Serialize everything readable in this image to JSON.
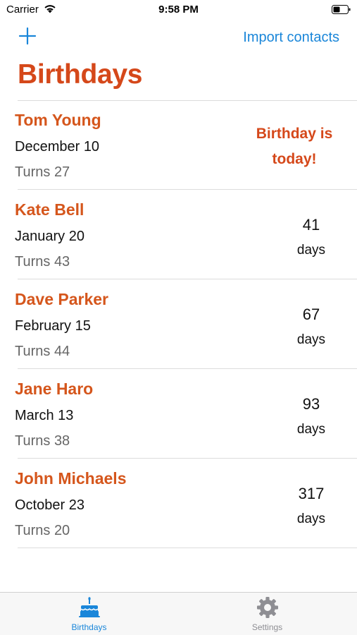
{
  "status_bar": {
    "carrier": "Carrier",
    "time": "9:58 PM",
    "icons": [
      "wifi-icon",
      "battery-icon"
    ]
  },
  "nav": {
    "add_icon": "plus-icon",
    "import_label": "Import contacts"
  },
  "page": {
    "title": "Birthdays"
  },
  "colors": {
    "accent_orange": "#d5481a",
    "link_blue": "#1a86d9",
    "secondary_text": "#666666"
  },
  "birthdays": [
    {
      "name": "Tom Young",
      "date": "December 10",
      "turns": "Turns 27",
      "today_label": "Birthday is today!"
    },
    {
      "name": "Kate Bell",
      "date": "January 20",
      "turns": "Turns 43",
      "days_value": "41",
      "days_unit": "days"
    },
    {
      "name": "Dave Parker",
      "date": "February 15",
      "turns": "Turns 44",
      "days_value": "67",
      "days_unit": "days"
    },
    {
      "name": "Jane Haro",
      "date": "March 13",
      "turns": "Turns 38",
      "days_value": "93",
      "days_unit": "days"
    },
    {
      "name": "John Michaels",
      "date": "October 23",
      "turns": "Turns 20",
      "days_value": "317",
      "days_unit": "days"
    }
  ],
  "tab_bar": {
    "tabs": [
      {
        "label": "Birthdays",
        "icon": "cake-icon",
        "selected": true
      },
      {
        "label": "Settings",
        "icon": "gear-icon",
        "selected": false
      }
    ]
  }
}
